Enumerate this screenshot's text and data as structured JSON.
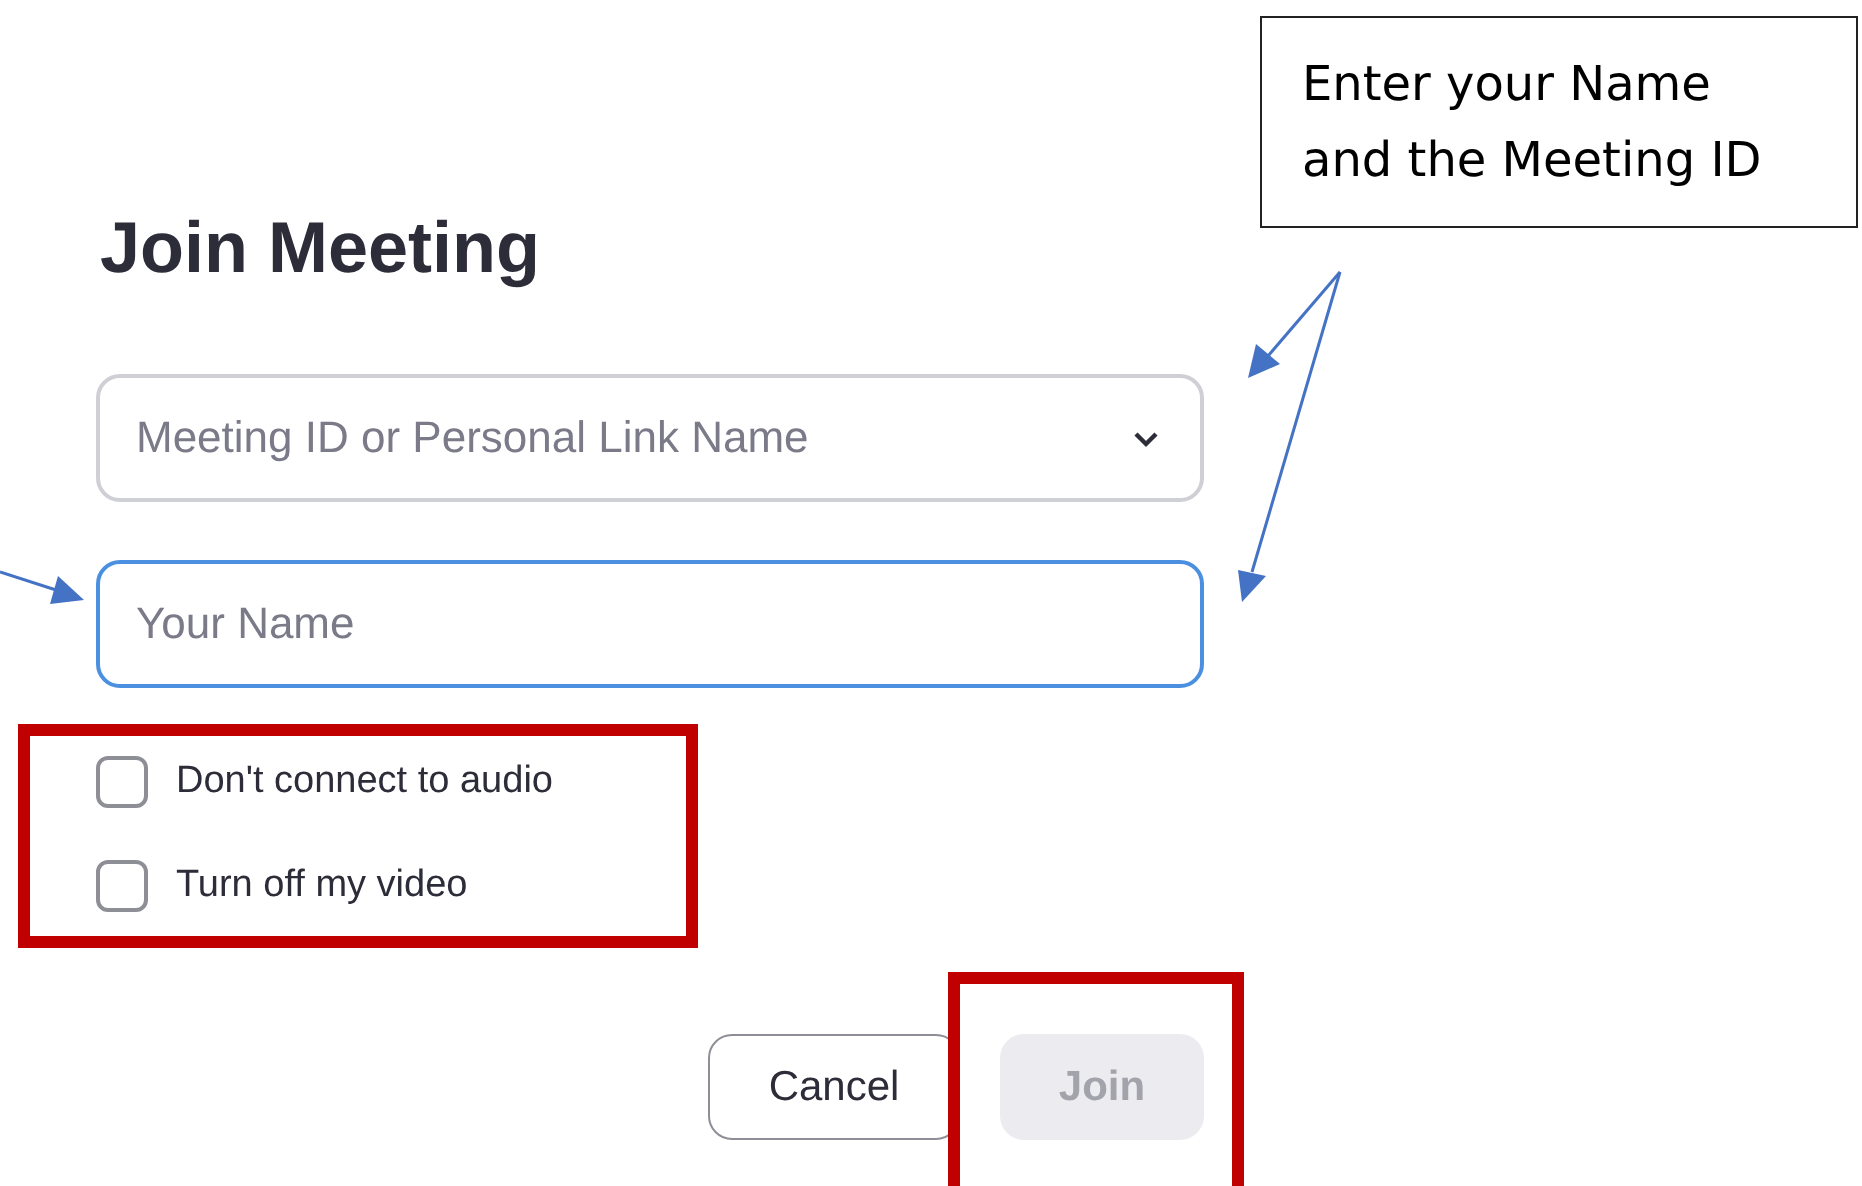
{
  "heading": "Join Meeting",
  "meeting_id_field": {
    "placeholder": "Meeting ID or Personal Link Name"
  },
  "name_field": {
    "placeholder": "Your Name",
    "focused": true
  },
  "options": [
    {
      "label": "Don't connect to audio",
      "checked": false
    },
    {
      "label": "Turn off my video",
      "checked": false
    }
  ],
  "buttons": [
    {
      "label": "Cancel",
      "kind": "secondary",
      "disabled": false
    },
    {
      "label": "Join",
      "kind": "primary",
      "disabled": true
    }
  ],
  "annotation": {
    "text": "Enter your Name and the Meeting ID"
  }
}
